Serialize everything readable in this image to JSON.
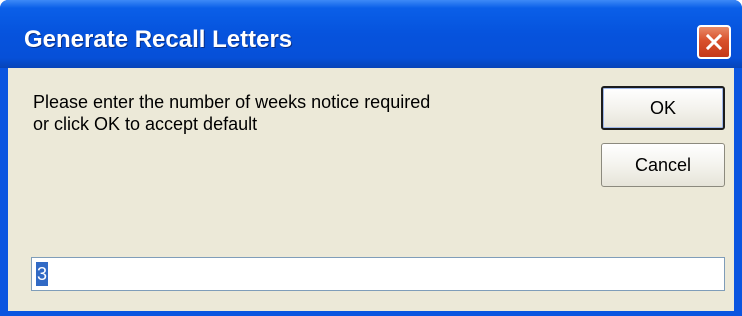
{
  "window": {
    "title": "Generate Recall Letters"
  },
  "dialog": {
    "message_line1": "Please enter the number of weeks notice required",
    "message_line2": "or click OK to accept default",
    "ok_label": "OK",
    "cancel_label": "Cancel",
    "input_value": "3"
  },
  "colors": {
    "titlebar": "#0653dd",
    "client_bg": "#ece9d8",
    "close_button": "#d9512c",
    "selection": "#316ac5"
  },
  "icons": {
    "close": "close-icon"
  }
}
